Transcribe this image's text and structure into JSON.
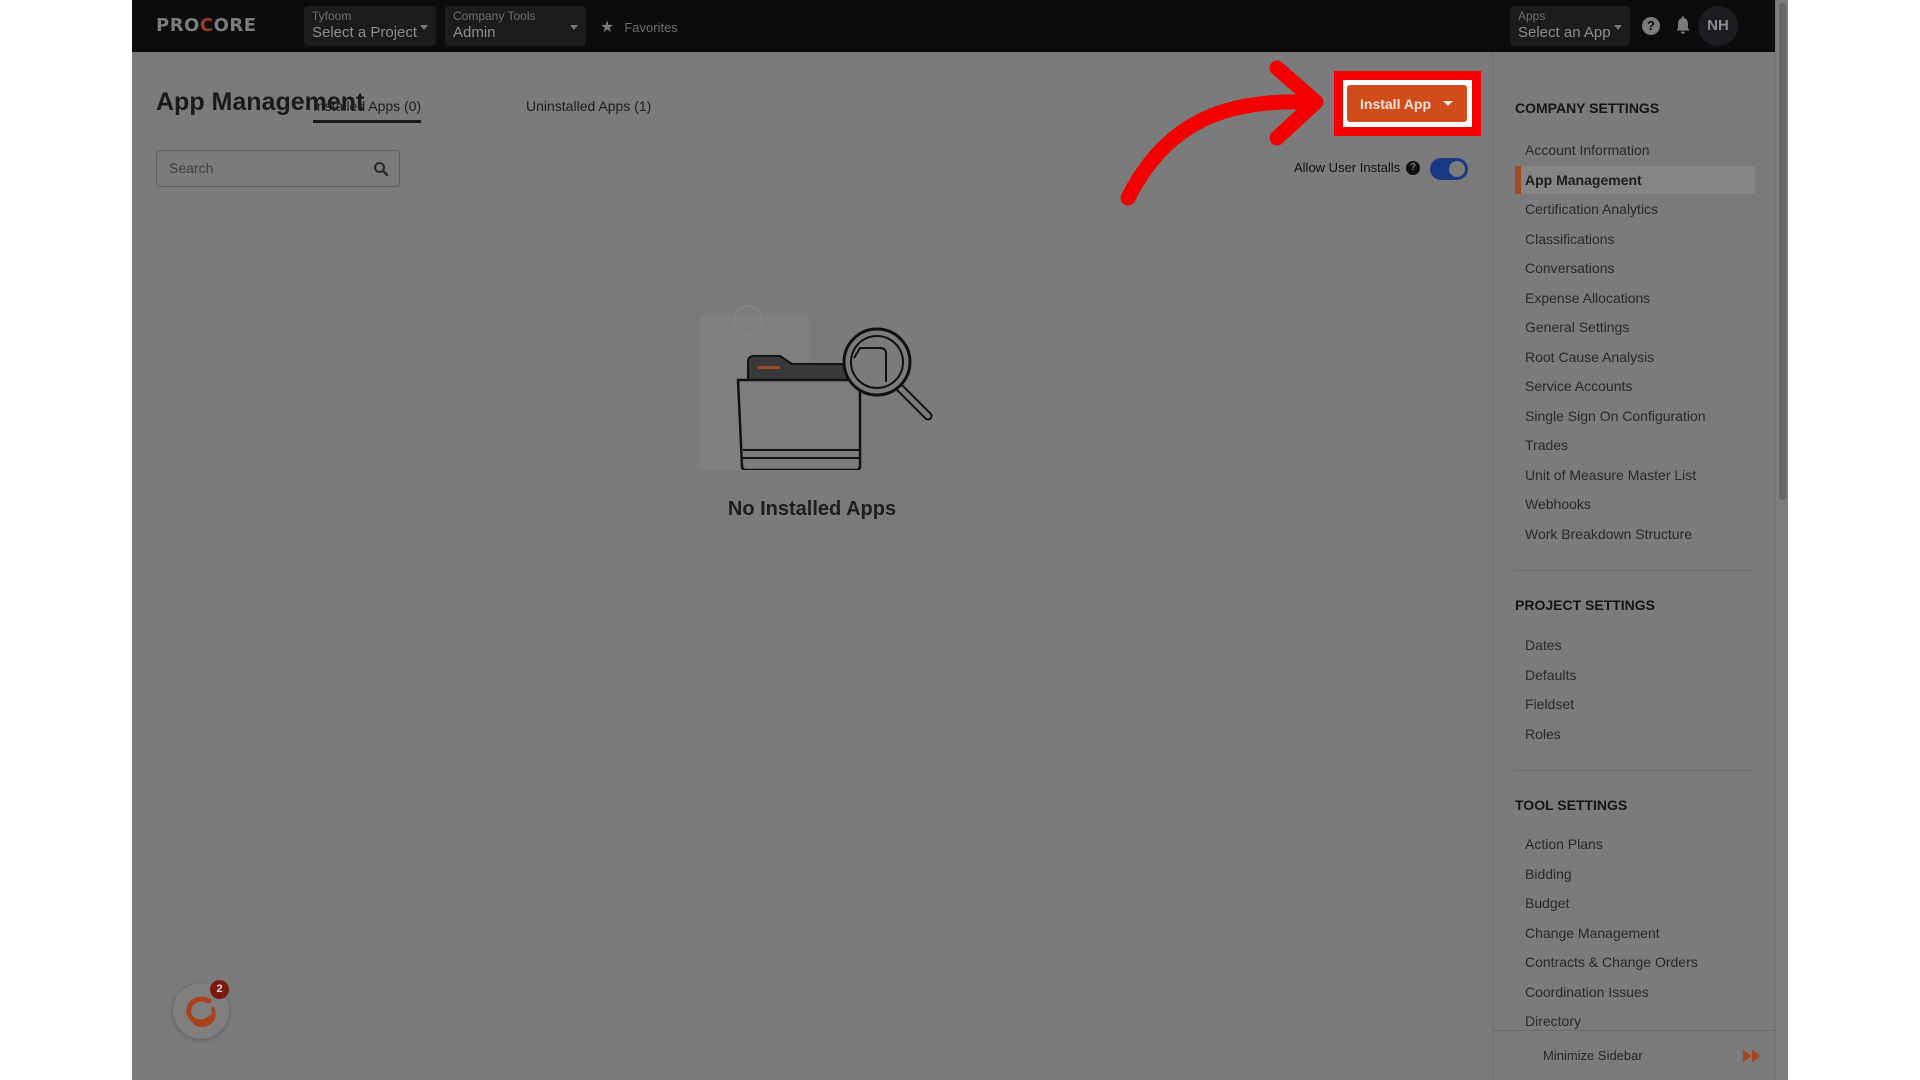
{
  "header": {
    "logo": "PROCORE",
    "project_dropdown": {
      "label": "Tyfoom",
      "value": "Select a Project"
    },
    "tools_dropdown": {
      "label": "Company Tools",
      "value": "Admin"
    },
    "favorites": "Favorites",
    "apps_dropdown": {
      "label": "Apps",
      "value": "Select an App"
    },
    "avatar_initials": "NH",
    "help_glyph": "?"
  },
  "main": {
    "title": "App Management",
    "tabs": [
      {
        "label": "Installed Apps (0)",
        "active": true
      },
      {
        "label": "Uninstalled Apps (1)",
        "active": false
      }
    ],
    "search": {
      "placeholder": "Search",
      "value": ""
    },
    "install_button": "Install App",
    "allow_user_installs": {
      "label": "Allow User Installs",
      "help_glyph": "?",
      "enabled": true
    },
    "empty_state": "No Installed Apps",
    "chat_badge_count": "2"
  },
  "sidebar": {
    "company_settings": {
      "title": "COMPANY SETTINGS",
      "items": [
        "Account Information",
        "App Management",
        "Certification Analytics",
        "Classifications",
        "Conversations",
        "Expense Allocations",
        "General Settings",
        "Root Cause Analysis",
        "Service Accounts",
        "Single Sign On Configuration",
        "Trades",
        "Unit of Measure Master List",
        "Webhooks",
        "Work Breakdown Structure"
      ],
      "active": "App Management"
    },
    "project_settings": {
      "title": "PROJECT SETTINGS",
      "items": [
        "Dates",
        "Defaults",
        "Fieldset",
        "Roles"
      ]
    },
    "tool_settings": {
      "title": "TOOL SETTINGS",
      "items": [
        "Action Plans",
        "Bidding",
        "Budget",
        "Change Management",
        "Contracts & Change Orders",
        "Coordination Issues",
        "Directory"
      ]
    },
    "minimize_label": "Minimize Sidebar"
  },
  "colors": {
    "brand_orange": "#d04d1b",
    "annotation_red": "#f40000",
    "toggle_on": "#1b3a86",
    "header_bg": "#0c0c0d",
    "overlay_gray": "#7b7b7b"
  }
}
